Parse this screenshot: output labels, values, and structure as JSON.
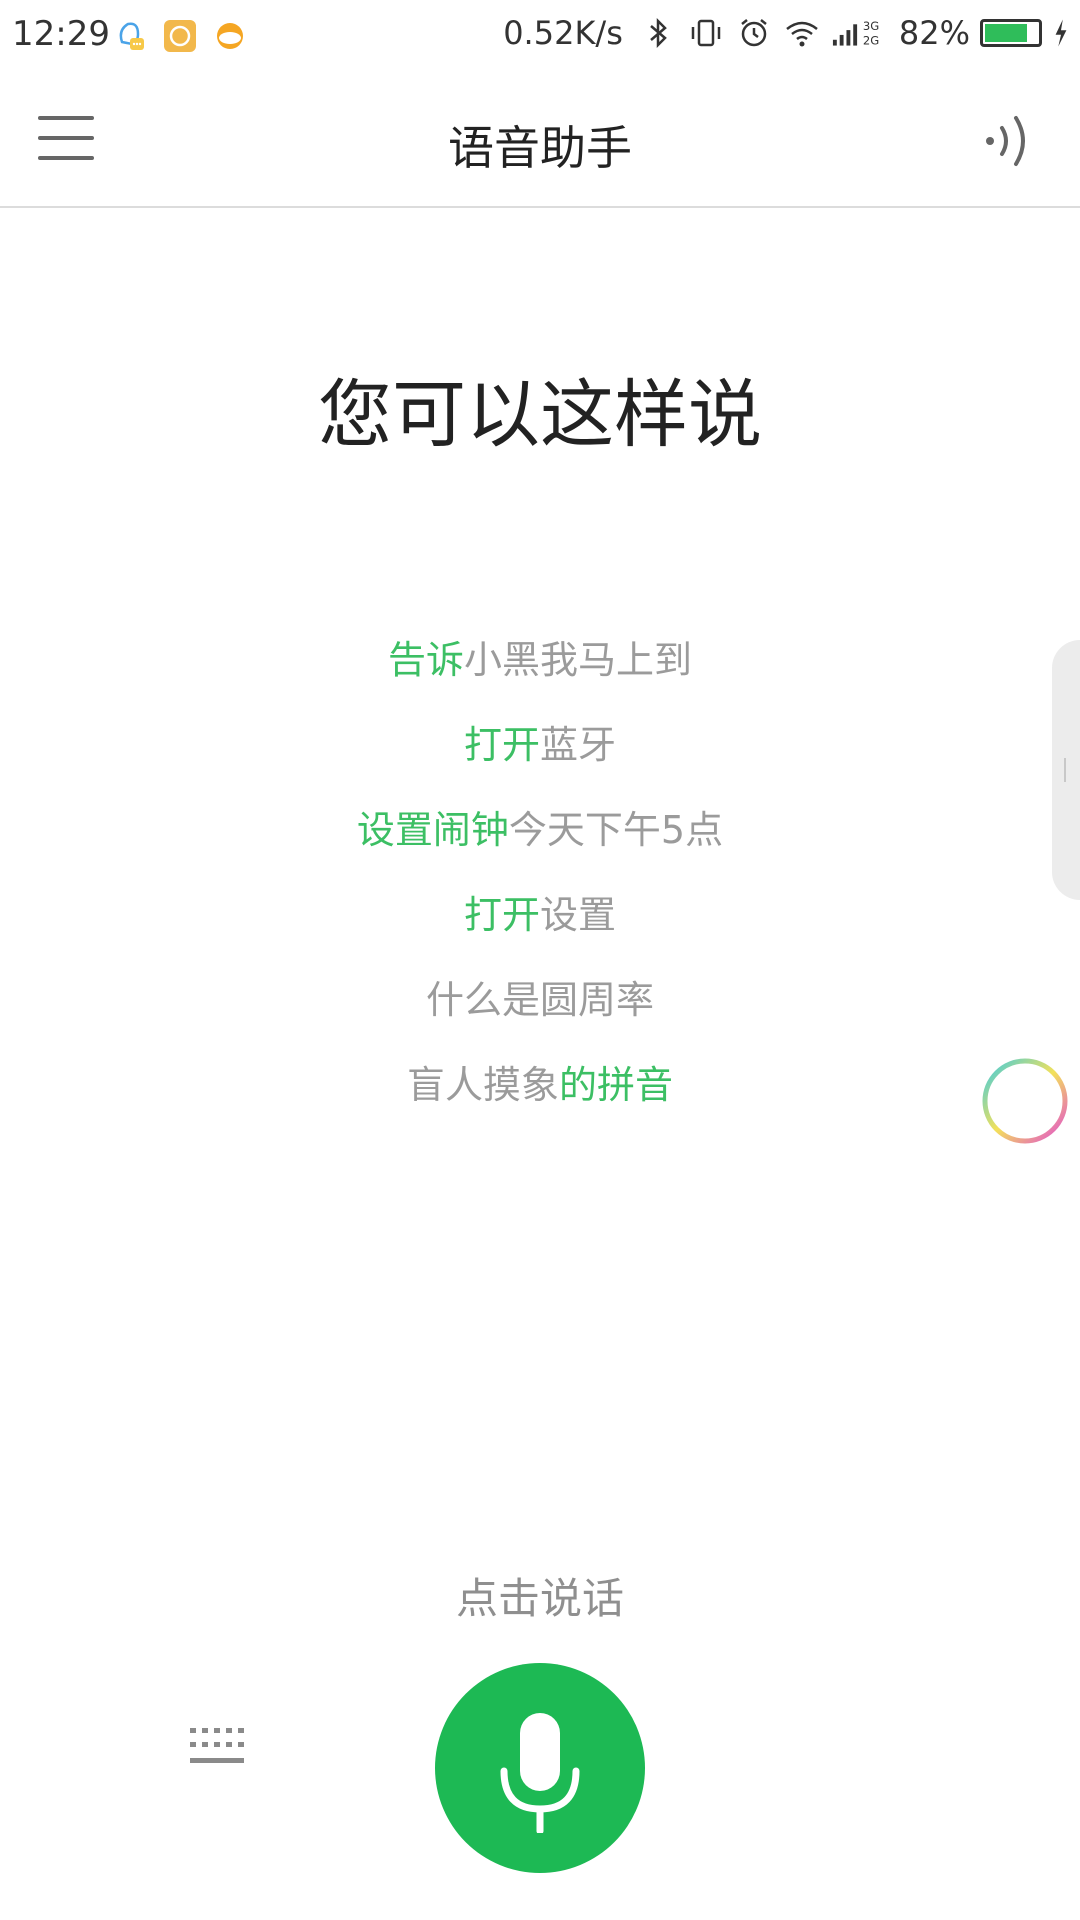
{
  "status_bar": {
    "time": "12:29",
    "network_speed": "0.52K/s",
    "network_type_top": "3G",
    "network_type_bottom": "2G",
    "battery_percent": "82%",
    "battery_level": 0.82,
    "icons": [
      "qq-icon",
      "app-icon",
      "weather-icon",
      "bluetooth-icon",
      "vibrate-icon",
      "alarm-icon",
      "wifi-icon",
      "signal-icon",
      "battery-icon",
      "charging-icon"
    ]
  },
  "header": {
    "title": "语音助手",
    "menu_icon": "menu-icon",
    "speaker_icon": "speaker-icon"
  },
  "main": {
    "heading": "您可以这样说",
    "examples": [
      {
        "highlight": "告诉",
        "rest": "小黑我马上到"
      },
      {
        "highlight": "打开",
        "rest": "蓝牙"
      },
      {
        "highlight": "设置闹钟",
        "rest": "今天下午5点"
      },
      {
        "highlight": "打开",
        "rest": "设置"
      },
      {
        "plain": "什么是圆周率"
      },
      {
        "plain_first": "盲人摸象",
        "highlight_last": "的拼音"
      }
    ]
  },
  "footer": {
    "tap_hint": "点击说话",
    "keyboard_icon": "keyboard-icon",
    "mic_icon": "microphone-icon"
  },
  "colors": {
    "accent_green": "#1db954",
    "highlight_green": "#3cbf64",
    "text_gray": "#9b9b9b"
  }
}
